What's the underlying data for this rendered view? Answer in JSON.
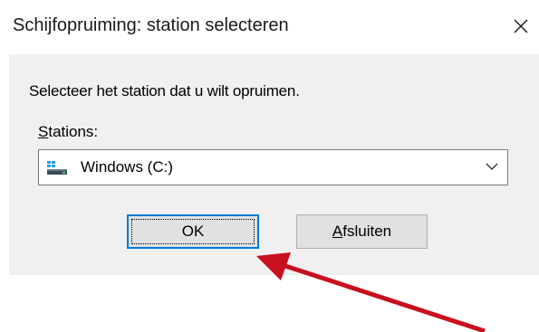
{
  "window": {
    "title": "Schijfopruiming: station selecteren",
    "close_icon": "close-icon"
  },
  "dialog": {
    "instruction": "Selecteer het station dat u wilt opruimen.",
    "drives_label_mnemonic": "S",
    "drives_label_rest": "tations:",
    "selected_drive": "Windows (C:)",
    "drive_icon": "hard-drive-icon",
    "dropdown_icon": "chevron-down-icon"
  },
  "buttons": {
    "ok_label": "OK",
    "close_label_mnemonic": "A",
    "close_label_rest": "fsluiten"
  },
  "annotation": {
    "arrow_icon": "red-arrow-icon",
    "arrow_color": "#c8101e"
  },
  "colors": {
    "dialog_background": "#f0f0f0",
    "focus_border": "#0078d7",
    "button_face": "#e1e1e1"
  }
}
